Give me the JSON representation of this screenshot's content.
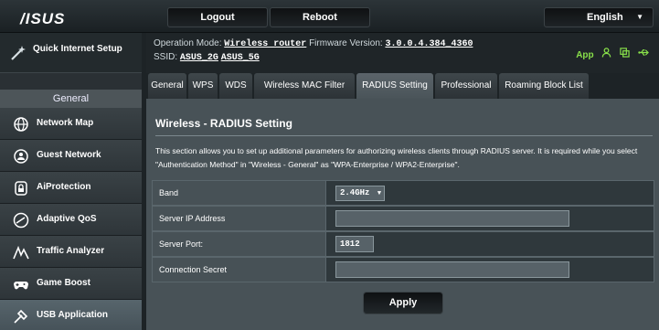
{
  "header": {
    "logo": "/ISUS",
    "logout_label": "Logout",
    "reboot_label": "Reboot",
    "language": "English"
  },
  "info": {
    "op_mode_prefix": "Operation Mode:",
    "op_mode_value": "Wireless router",
    "firmware_prefix": "Firmware Version:",
    "firmware_value": "3.0.0.4.384_4360",
    "ssid_prefix": "SSID:",
    "ssid_2g": "ASUS_2G",
    "ssid_5g": "ASUS_5G",
    "app_label": "App"
  },
  "sidebar": {
    "quick_setup": "Quick Internet Setup",
    "section_header": "General",
    "items": [
      {
        "label": "Network Map"
      },
      {
        "label": "Guest Network"
      },
      {
        "label": "AiProtection"
      },
      {
        "label": "Adaptive QoS"
      },
      {
        "label": "Traffic Analyzer"
      },
      {
        "label": "Game Boost"
      },
      {
        "label": "USB Application"
      }
    ]
  },
  "tabs": [
    {
      "label": "General"
    },
    {
      "label": "WPS"
    },
    {
      "label": "WDS"
    },
    {
      "label": "Wireless MAC Filter"
    },
    {
      "label": "RADIUS Setting"
    },
    {
      "label": "Professional"
    },
    {
      "label": "Roaming Block List"
    }
  ],
  "main": {
    "title": "Wireless - RADIUS Setting",
    "description": "This section allows you to set up additional parameters for authorizing wireless clients through RADIUS server. It is required while you select \"Authentication Method\" in \"Wireless - General\" as \"WPA-Enterprise / WPA2-Enterprise\".",
    "fields": {
      "band_label": "Band",
      "band_value": "2.4GHz",
      "server_ip_label": "Server IP Address",
      "server_ip_value": "",
      "server_port_label": "Server Port:",
      "server_port_value": "1812",
      "secret_label": "Connection Secret",
      "secret_value": ""
    },
    "apply_label": "Apply"
  },
  "colors": {
    "active_tab": "#5b646a",
    "content_bg": "#485257",
    "status_icons": "#88e04a"
  }
}
